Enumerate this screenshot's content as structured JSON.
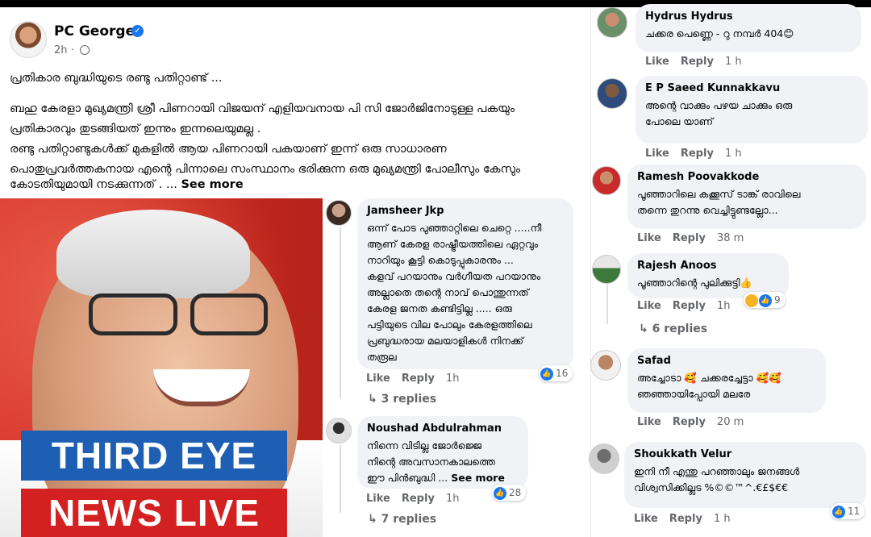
{
  "post": {
    "author": "PC George",
    "time": "2h ·",
    "lines": [
      "പ്രതികാര ബുദ്ധിയുടെ രണ്ടു പതിറ്റാണ്ട് ...",
      "ബഹു കേരളാ മുഖ്യമന്ത്രി ശ്രീ പിണറായി വിജയന് എളിയവനായ പി സി ജോർജിനോടുള്ള പകയും",
      "പ്രതികാരവും തുടങ്ങിയത് ഇന്നും ഇന്നലെയുമല്ല .",
      "രണ്ടു പതിറ്റാണ്ടുകൾക്ക് മുകളിൽ ആയ പിണറായി പകയാണ് ഇന്ന് ഒരു സാധാരണ",
      "പൊതുപ്രവർത്തകനായ എന്റെ പിന്നാലെ സംസ്ഥാനം ഭരിക്കുന്ന ഒരു മുഖ്യമന്ത്രി പോലീസും കേസും",
      "കോടതിയുമായി നടക്കുന്നത് . ..."
    ],
    "see_more": "See more"
  },
  "image": {
    "badge_top": "THIRD EYE",
    "badge_bottom": "NEWS LIVE"
  },
  "comments_mid": [
    {
      "name": "Jamsheer Jkp",
      "lines": [
        "ഒന്ന് പോട പുഞ്ഞാറ്റിലെ ചെറ്റെ .....നീ",
        "ആണ് കേരള രാഷ്ട്രീയത്തിലെ ഏറ്റവും",
        "നാറിയും കൂട്ടി കൊടുപ്പുകാരനും ...",
        "കളവ് പറയാനും വർഗീയത പറയാനും",
        "അല്ലാതെ തന്റെ നാവ് പൊന്തുന്നത്",
        "കേരള ജനത കണ്ടിട്ടില്ല ..... ഒരു",
        "പട്ടിയുടെ വില പോലും കേരളത്തിലെ",
        "പ്രബുദ്ധരായ മലയാളികൾ നിനക്ക്",
        "തരൂല"
      ],
      "like": "Like",
      "reply": "Reply",
      "time": "1h",
      "reactions": "16",
      "replies": "↳ 3 replies"
    },
    {
      "name": "Noushad Abdulrahman",
      "lines": [
        "നിന്നെ വിടില്ല ജോർജ്ജെ",
        "നിന്റെ അവസാനകാലത്തെ",
        "ഈ പിൻബുദ്ധി ..."
      ],
      "see_more": "See more",
      "like": "Like",
      "reply": "Reply",
      "time": "1h",
      "reactions": "28",
      "replies": "↳ 7 replies"
    }
  ],
  "comments_right": [
    {
      "name": "Hydrus Hydrus",
      "lines": [
        "ചക്കര പെണ്ണെ - റു നമ്പർ 404😊"
      ],
      "like": "Like",
      "reply": "Reply",
      "time": "1 h"
    },
    {
      "name": "E P Saeed Kunnakkavu",
      "lines": [
        "അന്റെ വാക്കും പഴയ ചാക്കും ഒരു",
        "പോലെ യാണ്"
      ],
      "like": "Like",
      "reply": "Reply",
      "time": "1 h"
    },
    {
      "name": "Ramesh Poovakkode",
      "lines": [
        "പൂഞ്ഞാറിലെ കക്കൂസ് ടാങ്ക് രാവിലെ",
        "തന്നെ തുറന്നു വെച്ചിട്ടുണ്ടല്ലോ..."
      ],
      "like": "Like",
      "reply": "Reply",
      "time": "38 m"
    },
    {
      "name": "Rajesh Anoos",
      "lines": [
        "പൂഞ്ഞാറിന്റെ പുലിക്കുട്ടി👍"
      ],
      "like": "Like",
      "reply": "Reply",
      "time": "1h",
      "reactions": "9",
      "replies": "↳ 6 replies"
    },
    {
      "name": "Safad",
      "lines": [
        "അച്ചോടാ 🥰 ചക്കരച്ചേട്ടാ 🥰🥰",
        "ഞഞ്ഞായിപ്പോയി മലരേ"
      ],
      "like": "Like",
      "reply": "Reply",
      "time": "20 m"
    },
    {
      "name": "Shoukkath Velur",
      "lines": [
        "ഇനി നീ എന്തു പറഞ്ഞാലും ജനങ്ങൾ",
        "വിശ്വസിക്കില്ലട %©©™^.€£$€€"
      ],
      "like": "Like",
      "reply": "Reply",
      "time": "1 h",
      "reactions": "11"
    }
  ],
  "colors": {
    "facebook_blue": "#1877f2",
    "bubble": "#f0f2f5",
    "badge_blue": "#1e5fb4",
    "badge_red": "#d32020"
  }
}
